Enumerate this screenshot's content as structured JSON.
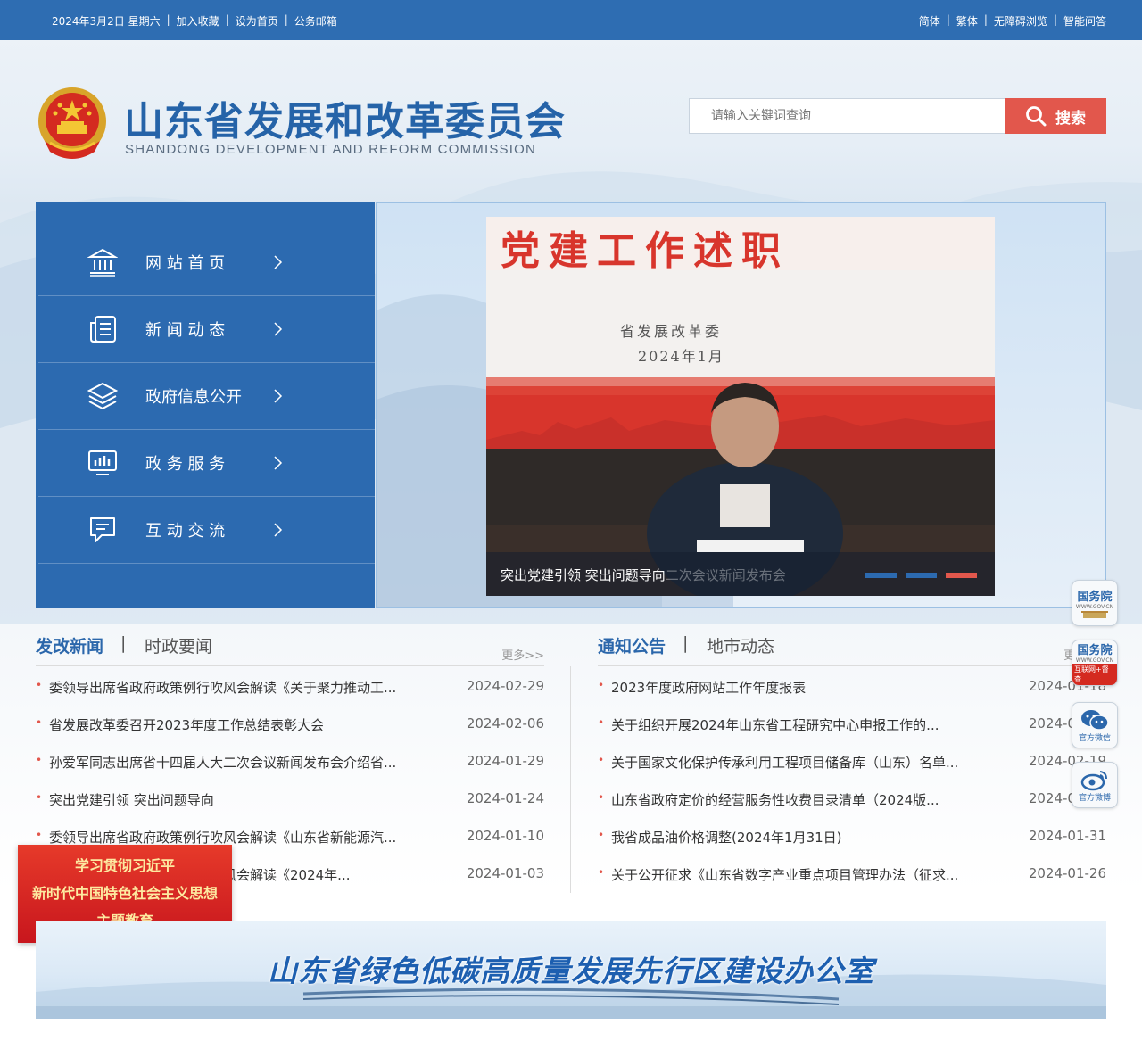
{
  "topbar": {
    "date": "2024年3月2日 星期六",
    "left_links": [
      "加入收藏",
      "设为首页",
      "公务邮箱"
    ],
    "right_links": [
      "简体",
      "繁体",
      "无障碍浏览",
      "智能问答"
    ]
  },
  "header": {
    "title": "山东省发展和改革委员会",
    "subtitle": "SHANDONG DEVELOPMENT AND REFORM COMMISSION",
    "search_placeholder": "请输入关键词查询",
    "search_label": "搜索"
  },
  "nav": {
    "items": [
      {
        "label": "网 站 首 页",
        "icon": "home-icon"
      },
      {
        "label": "新 闻 动 态",
        "icon": "news-icon"
      },
      {
        "label": "政府信息公开",
        "icon": "layers-icon"
      },
      {
        "label": "政 务 服 务",
        "icon": "monitor-chart-icon"
      },
      {
        "label": "互 动 交 流",
        "icon": "chat-icon"
      }
    ]
  },
  "slider": {
    "slide_banner_text": "党建工作述职",
    "slide_sub1": "省发展改革委",
    "slide_sub2": "2024年1月",
    "caption": "突出党建引领 突出问题导向",
    "caption_ghost": "二次会议新闻发布会",
    "active_dot": 2
  },
  "news_left": {
    "tabs": [
      "发改新闻",
      "时政要闻"
    ],
    "more": "更多>>",
    "items": [
      {
        "title": "委领导出席省政府政策例行吹风会解读《关于聚力推动工...",
        "date": "2024-02-29"
      },
      {
        "title": "省发展改革委召开2023年度工作总结表彰大会",
        "date": "2024-02-06"
      },
      {
        "title": "孙爱军同志出席省十四届人大二次会议新闻发布会介绍省...",
        "date": "2024-01-29"
      },
      {
        "title": "突出党建引领 突出问题导向",
        "date": "2024-01-24"
      },
      {
        "title": "委领导出席省政府政策例行吹风会解读《山东省新能源汽...",
        "date": "2024-01-10"
      },
      {
        "title": "委领导出席省政府政策例行吹风会解读《2024年...",
        "date": "2024-01-03"
      }
    ]
  },
  "news_right": {
    "tabs": [
      "通知公告",
      "地市动态"
    ],
    "more": "更多>>",
    "items": [
      {
        "title": "2023年度政府网站工作年度报表",
        "date": "2024-01-18"
      },
      {
        "title": "关于组织开展2024年山东省工程研究中心申报工作的...",
        "date": "2024-02-05"
      },
      {
        "title": "关于国家文化保护传承利用工程项目储备库（山东）名单...",
        "date": "2024-02-19"
      },
      {
        "title": "山东省政府定价的经营服务性收费目录清单（2024版...",
        "date": "2024-02-01"
      },
      {
        "title": "我省成品油价格调整(2024年1月31日)",
        "date": "2024-01-31"
      },
      {
        "title": "关于公开征求《山东省数字产业重点项目管理办法（征求...",
        "date": "2024-01-26"
      }
    ]
  },
  "float_icons": [
    {
      "title": "国务院",
      "sub": "WWW.GOV.CN"
    },
    {
      "title": "国务院",
      "sub": "互联网+督查"
    },
    {
      "title": "",
      "sub": "官方微信"
    },
    {
      "title": "",
      "sub": "官方微博"
    }
  ],
  "theme_ad": {
    "line1": "学习贯彻习近平",
    "line2": "新时代中国特色社会主义思想",
    "line3": "主题教育"
  },
  "bottom_banner": {
    "text": "山东省绿色低碳高质量发展先行区建设办公室"
  },
  "colors": {
    "primary_blue": "#2c6ab0",
    "accent_red": "#e2574c"
  }
}
